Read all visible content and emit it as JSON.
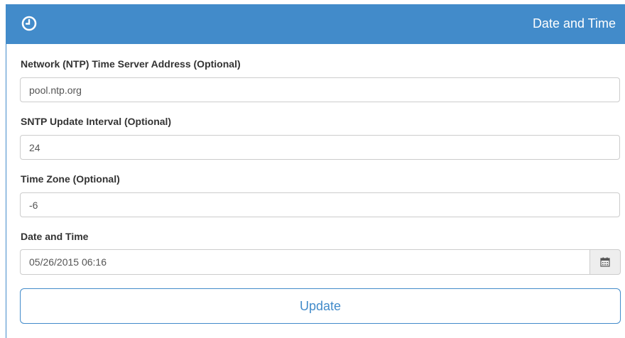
{
  "header": {
    "title": "Date and Time",
    "icon": "clock-icon",
    "color": "#428bca"
  },
  "form": {
    "ntp_server": {
      "label": "Network (NTP) Time Server Address (Optional)",
      "value": "pool.ntp.org"
    },
    "sntp_interval": {
      "label": "SNTP Update Interval (Optional)",
      "value": "24"
    },
    "time_zone": {
      "label": "Time Zone (Optional)",
      "value": "-6"
    },
    "date_time": {
      "label": "Date and Time",
      "value": "05/26/2015 06:16",
      "icon": "calendar-icon"
    }
  },
  "actions": {
    "update_label": "Update"
  }
}
